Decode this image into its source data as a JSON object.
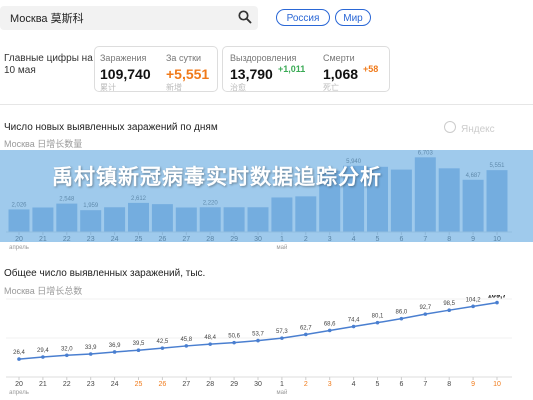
{
  "search": {
    "text": "Москва 莫斯科"
  },
  "chips": [
    "Россия",
    "Мир"
  ],
  "key_figures": {
    "title": "Главные цифры на 10 мая",
    "stats": [
      {
        "label": "Заражения",
        "value": "109,740",
        "delta": "",
        "sub": "累计"
      },
      {
        "label": "За сутки",
        "value": "+5,551",
        "delta": "",
        "sub": "新增"
      },
      {
        "label": "Выздоровления",
        "value": "13,790",
        "delta": "+1,011",
        "sub": "治愈"
      },
      {
        "label": "Смерти",
        "value": "1,068",
        "delta": "+58",
        "sub": "死亡"
      }
    ]
  },
  "colors": {
    "accent": "#2a67d6",
    "orange": "#f07a1a",
    "green": "#3aaa55",
    "bar": "#8fb3dc",
    "line": "#4a7fd0",
    "overlay": "#64aae1"
  },
  "yandex_label": "Яндекс",
  "overlay_title": "禹村镇新冠病毒实时数据追踪分析",
  "chart_data": [
    {
      "type": "bar",
      "title": "Число новых выявленных заражений по дням",
      "subtitle": "Москва 日增长数量",
      "categories": [
        "20",
        "21",
        "22",
        "23",
        "24",
        "25",
        "26",
        "27",
        "28",
        "29",
        "30",
        "1",
        "2",
        "3",
        "4",
        "5",
        "6",
        "7",
        "8",
        "9",
        "10"
      ],
      "values": [
        2026,
        2200,
        2548,
        1959,
        2220,
        2612,
        2500,
        2200,
        2220,
        2220,
        2220,
        3100,
        3200,
        5500,
        5940,
        5850,
        5600,
        6703,
        5714,
        4687,
        5551
      ],
      "value_labels": [
        "2,026",
        "",
        "2,548",
        "1,959",
        "",
        "2,612",
        "",
        "",
        "2,220",
        "",
        "",
        "",
        "",
        "",
        "5,940",
        "",
        "",
        "6,703",
        "",
        "4,687",
        "5,551"
      ],
      "x_month_labels": {
        "0": "апрель",
        "11": "май"
      },
      "weekend_categories": [],
      "ylim": [
        0,
        7000
      ]
    },
    {
      "type": "line",
      "title": "Общее число выявленных заражений, тыс.",
      "subtitle": "Москва 日增长总数",
      "categories": [
        "20",
        "21",
        "22",
        "23",
        "24",
        "25",
        "26",
        "27",
        "28",
        "29",
        "30",
        "1",
        "2",
        "3",
        "4",
        "5",
        "6",
        "7",
        "8",
        "9",
        "10"
      ],
      "values": [
        26.4,
        29.4,
        32.0,
        33.9,
        36.9,
        39.5,
        42.5,
        45.8,
        48.4,
        50.6,
        53.7,
        57.3,
        62.7,
        68.6,
        74.4,
        80.1,
        86.0,
        92.7,
        98.5,
        104.2,
        109.7
      ],
      "value_labels": [
        "26,4",
        "29,4",
        "32,0",
        "33,9",
        "36,9",
        "39,5",
        "42,5",
        "45,8",
        "48,4",
        "50,6",
        "53,7",
        "57,3",
        "62,7",
        "68,6",
        "74,4",
        "80,1",
        "86,0",
        "92,7",
        "98,5",
        "104,2",
        "109,7"
      ],
      "x_month_labels": {
        "0": "апрель",
        "11": "май"
      },
      "weekend_categories": [
        "25",
        "26",
        "2",
        "3",
        "9",
        "10"
      ],
      "ylim": [
        0,
        115
      ]
    }
  ]
}
